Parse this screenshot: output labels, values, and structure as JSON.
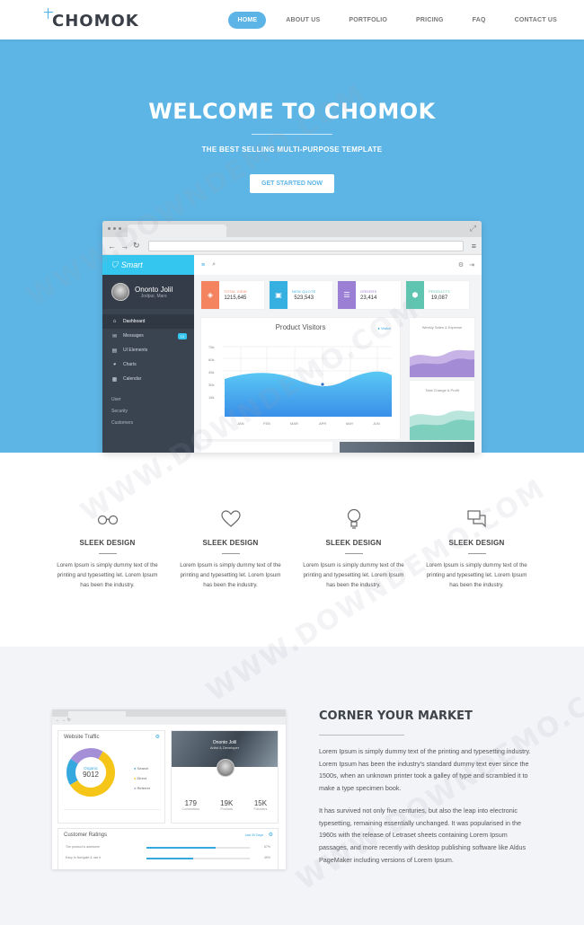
{
  "nav": {
    "logo": "CHOMOK",
    "items": [
      "HOME",
      "ABOUT US",
      "PORTFOLIO",
      "PRICING",
      "FAQ",
      "CONTACT US"
    ],
    "active": "HOME"
  },
  "hero": {
    "title": "WELCOME TO CHOMOK",
    "subtitle": "THE BEST SELLING MULTI-PURPOSE TEMPLATE",
    "cta": "GET STARTED NOW"
  },
  "dashboard": {
    "brand": "Smart",
    "user": {
      "name": "Ononto Jolil",
      "location": "Jodpur, Mars"
    },
    "menu": [
      {
        "label": "Dashboard",
        "icon": "home-icon"
      },
      {
        "label": "Messages",
        "icon": "mail-icon",
        "badge": "12"
      },
      {
        "label": "UI Elements",
        "icon": "layers-icon"
      },
      {
        "label": "Charts",
        "icon": "pie-icon"
      },
      {
        "label": "Calendar",
        "icon": "calendar-icon"
      }
    ],
    "submenu": [
      "User",
      "Security",
      "Customers"
    ],
    "stats": [
      {
        "label": "TOTAL VIEW",
        "value": "1215,645",
        "color": "#f4845f"
      },
      {
        "label": "NEW QUOTE",
        "value": "523,543",
        "color": "#35b0e0"
      },
      {
        "label": "ORDERS",
        "value": "23,414",
        "color": "#9b7fd4"
      },
      {
        "label": "PRODUCTS",
        "value": "19,087",
        "color": "#5fc5b0"
      }
    ],
    "product_visitors": {
      "title": "Product Visitors",
      "legend": "Visitor",
      "y_ticks": [
        "75k",
        "60k",
        "45k",
        "30k",
        "15k"
      ],
      "x_ticks": [
        "JAN",
        "FEB",
        "MAR",
        "APR",
        "MAY",
        "JUN"
      ]
    },
    "side_cards": [
      "Weekly Sales & Expense",
      "Total Change & Profit"
    ]
  },
  "features": [
    {
      "icon": "glasses-icon",
      "title": "SLEEK DESIGN",
      "text": "Lorem Ipsum is simply dummy text of the printing and typesetting let. Lorem Ipsum has been the industry."
    },
    {
      "icon": "heart-icon",
      "title": "SLEEK DESIGN",
      "text": "Lorem Ipsum is simply dummy text of the printing and typesetting let. Lorem Ipsum has been the industry."
    },
    {
      "icon": "lightbulb-icon",
      "title": "SLEEK DESIGN",
      "text": "Lorem Ipsum is simply dummy text of the printing and typesetting let. Lorem Ipsum has been the industry."
    },
    {
      "icon": "chat-icon",
      "title": "SLEEK DESIGN",
      "text": "Lorem Ipsum is simply dummy text of the printing and typesetting let. Lorem Ipsum has been the industry."
    }
  ],
  "mini_dashboard": {
    "traffic_title": "Website Traffic",
    "donut_label": "Organic",
    "donut_value": "9012",
    "legend": [
      "Search",
      "Direct",
      "Referrer"
    ],
    "profile_name": "Ononto Jolil",
    "profile_role": "Artist & Developer",
    "profile_stats": [
      {
        "value": "179",
        "label": "Connections"
      },
      {
        "value": "19K",
        "label": "Products"
      },
      {
        "value": "15K",
        "label": "Followers"
      }
    ],
    "ratings_title": "Customer Ratings",
    "ratings_link": "Last 30 Days",
    "ratings_rows": [
      {
        "label": "The product is awesome",
        "pct": "67%"
      },
      {
        "label": "Easy to Navigate & use it",
        "pct": "45%"
      }
    ]
  },
  "corner": {
    "title": "CORNER YOUR MARKET",
    "p1": "Lorem Ipsum is simply dummy text of the printing and typesetting industry. Lorem Ipsum has been the industry's standard dummy text ever since the 1500s, when an unknown printer took a galley of type and scrambled it to make a type specimen book.",
    "p2": "It has survived not only five centuries, but also the leap into electronic typesetting, remaining essentially unchanged. It was popularised in the 1960s with the release of Letraset sheets containing Lorem Ipsum passages, and more recently with desktop publishing software like Aldus PageMaker including versions of Lorem Ipsum."
  },
  "watermark": "WWW.DOWNDEMO.COM"
}
